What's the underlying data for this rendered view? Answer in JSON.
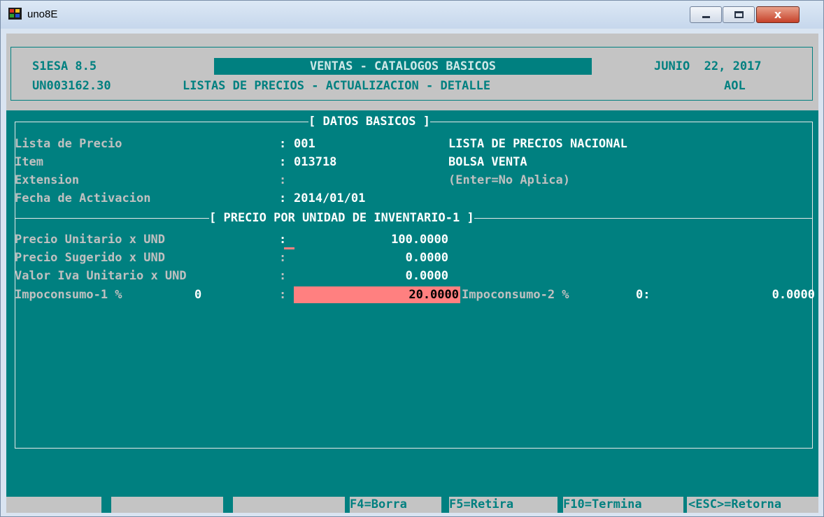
{
  "window": {
    "title": "uno8E",
    "close_glyph": "x",
    "icon": "app-icon"
  },
  "header": {
    "system": "S1ESA 8.5",
    "module_title": "VENTAS - CATALOGOS BASICOS",
    "date": "JUNIO  22, 2017",
    "program_code": "UN003162.30",
    "screen_title": "LISTAS DE PRECIOS - ACTUALIZACION - DETALLE",
    "user": "AOL"
  },
  "datos_basicos": {
    "section_title": "[ DATOS BASICOS ]",
    "rows": [
      {
        "label": "Lista de Precio",
        "sep": ":",
        "value": "001",
        "desc": "LISTA DE PRECIOS NACIONAL"
      },
      {
        "label": "Item",
        "sep": ":",
        "value": "013718",
        "desc": "BOLSA VENTA"
      },
      {
        "label": "Extension",
        "sep": ":",
        "value": "",
        "desc": "(Enter=No Aplica)"
      },
      {
        "label": "Fecha de Activacion",
        "sep": ":",
        "value": "2014/01/01",
        "desc": ""
      }
    ]
  },
  "precio": {
    "section_title": "[ PRECIO POR UNIDAD DE INVENTARIO-1 ]",
    "rows": [
      {
        "label": "Precio Unitario x UND",
        "sep": ":",
        "value": "100.0000"
      },
      {
        "label": "Precio Sugerido x UND",
        "sep": ":",
        "value": "0.0000"
      },
      {
        "label": "Valor Iva Unitario x UND",
        "sep": ":",
        "value": "0.0000"
      }
    ],
    "impoconsumo1": {
      "label": "Impoconsumo-1 %",
      "pct": "0",
      "sep": ":",
      "value": "20.0000"
    },
    "impoconsumo2": {
      "label": "Impoconsumo-2 %",
      "pct": "0:",
      "value": "0.0000"
    }
  },
  "function_keys": [
    "",
    "",
    "",
    "F4=Borra",
    "F5=Retira",
    "F10=Termina",
    "<ESC>=Retorna"
  ],
  "colors": {
    "terminal_bg": "#008080",
    "highlight": "#ff8080",
    "header_bg": "#c4c4c4"
  }
}
